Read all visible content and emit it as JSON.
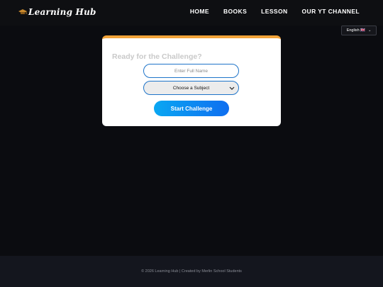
{
  "header": {
    "brand": "Learning Hub",
    "nav": [
      "HOME",
      "BOOKS",
      "LESSON",
      "OUR YT CHANNEL"
    ]
  },
  "language": {
    "selected": "English 🇬🇧"
  },
  "card": {
    "title": "Ready for the Challenge?",
    "name_placeholder": "Enter Full Name",
    "subject_selected": "Choose a Subject",
    "start_label": "Start Challenge"
  },
  "footer": {
    "text": "© 2026 Learning Hub | Created by Merlin School Students"
  },
  "colors": {
    "accent_border": "#f2a339",
    "button_gradient_start": "#0aa7f2",
    "button_gradient_end": "#0f6ef0",
    "input_border": "#1e74c9"
  }
}
